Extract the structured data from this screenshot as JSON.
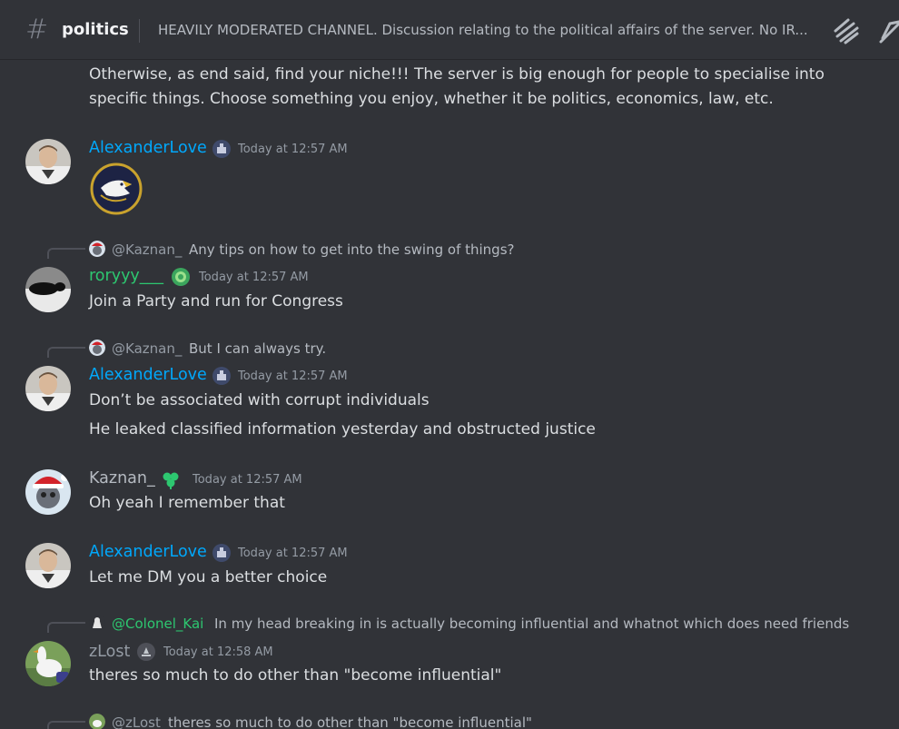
{
  "header": {
    "hash": "#",
    "channel_name": "politics",
    "topic": "HEAVILY MODERATED CHANNEL. Discussion relating to the political affairs of the server. No IR..."
  },
  "colors": {
    "alexander": "#00a8fc",
    "roryyy": "#2dc770",
    "kaznan": "#b5bac1",
    "zlost": "#949ba4",
    "colonel": "#2dc770"
  },
  "messages": {
    "cont_line1": "Otherwise, as end said, find your niche!!! The server is big enough for people to specialise into",
    "cont_line2": "specific things. Choose something you enjoy, whether it be politics, economics, law, etc.",
    "m1": {
      "author": "AlexanderLove",
      "time": "Today at 12:57 AM"
    },
    "m2": {
      "reply_name": "@Kaznan_",
      "reply_text": "Any tips on how to get into the swing of things?",
      "author": "roryyy___",
      "time": "Today at 12:57 AM",
      "text": "Join a Party and run for Congress"
    },
    "m3": {
      "reply_name": "@Kaznan_",
      "reply_text": "But I can always try.",
      "author": "AlexanderLove",
      "time": "Today at 12:57 AM",
      "text1": "Don’t be associated with corrupt individuals",
      "text2": "He leaked classified information yesterday and obstructed justice"
    },
    "m4": {
      "author": "Kaznan_",
      "time": "Today at 12:57 AM",
      "text": "Oh yeah I remember that"
    },
    "m5": {
      "author": "AlexanderLove",
      "time": "Today at 12:57 AM",
      "text": "Let me DM you a better choice"
    },
    "m6": {
      "reply_name": "@Colonel_Kai",
      "reply_text": "In my head breaking in is actually becoming influential and whatnot which does need friends ...",
      "author": "zLost",
      "time": "Today at 12:58 AM",
      "text": "theres so much to do other than \"become influential\""
    },
    "m7": {
      "reply_name": "@zLost",
      "reply_text": "theres so much to do other than \"become influential\""
    }
  }
}
